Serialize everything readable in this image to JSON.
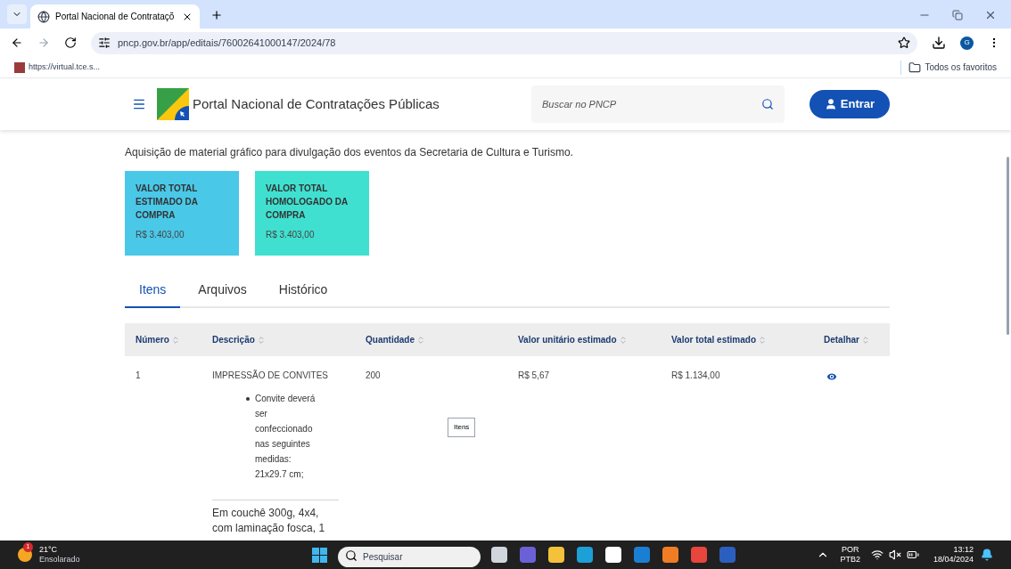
{
  "browser": {
    "tabs": [
      {
        "title": "Portal Nacional de Contrataçõ",
        "selected": true
      }
    ],
    "url": "pncp.gov.br/app/editais/76002641000147/2024/78",
    "profile_initial": "G",
    "bookmarks": [
      {
        "label": "https://virtual.tce.s..."
      }
    ],
    "bookmarks_folder": "Todos os favoritos"
  },
  "site": {
    "title": "Portal Nacional de Contratações Públicas",
    "search": {
      "placeholder": "Buscar no PNCP"
    },
    "login": "Entrar",
    "description": "Aquisição de material gráfico para divulgação dos eventos da Secretaria de Cultura e Turismo.",
    "value_cards": [
      {
        "label": "VALOR TOTAL ESTIMADO DA COMPRA",
        "value": "R$ 3.403,00",
        "color": "#4ac8e8"
      },
      {
        "label": "VALOR TOTAL HOMOLOGADO DA COMPRA",
        "value": "R$ 3.403,00",
        "color": "#40e0d0"
      }
    ],
    "tabs": [
      {
        "label": "Itens",
        "selected": true
      },
      {
        "label": "Arquivos",
        "selected": false
      },
      {
        "label": "Histórico",
        "selected": false
      }
    ],
    "table": {
      "columns": [
        "Número",
        "Descrição",
        "Quantidade",
        "Valor unitário estimado",
        "Valor total estimado",
        "Detalhar"
      ],
      "rows": [
        {
          "numero": "1",
          "descricao": "IMPRESSÃO DE CONVITES",
          "bullets": [
            "Convite deverá ser confeccionado nas seguintes medidas: 21x29.7 cm;"
          ],
          "extra_lines": [
            "Em couchê 300g, 4x4,",
            "com laminação fosca, 1"
          ],
          "quantidade": "200",
          "valor_unitario": "R$ 5,67",
          "valor_total": "R$ 1.134,00"
        }
      ]
    },
    "tooltip": "Itens"
  },
  "taskbar": {
    "temperature": "21°C",
    "condition": "Ensolarado",
    "weather_badge": "1",
    "search_placeholder": "Pesquisar",
    "language": "POR",
    "layout": "PTB2",
    "time": "13:12",
    "date": "18/04/2024"
  }
}
